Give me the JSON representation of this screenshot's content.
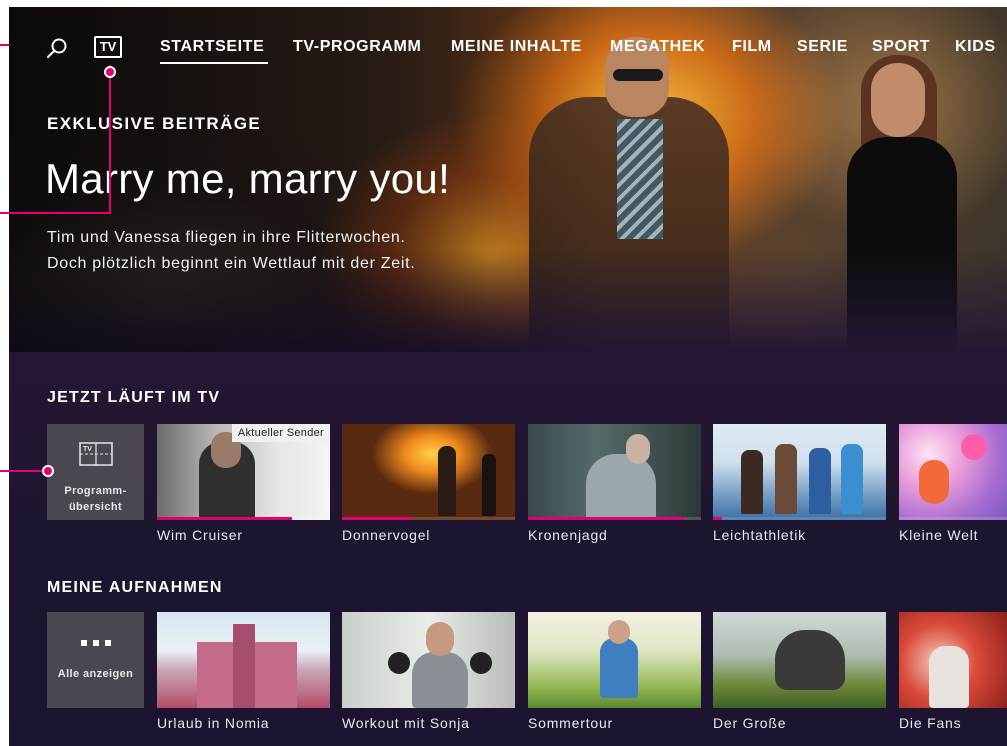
{
  "nav": {
    "tv_label": "TV",
    "items": [
      "STARTSEITE",
      "TV-PROGRAMM",
      "MEINE INHALTE",
      "MEGATHEK",
      "FILM",
      "SERIE",
      "SPORT",
      "KIDS"
    ],
    "active_index": 0
  },
  "hero": {
    "kicker": "EXKLUSIVE BEITRÄGE",
    "title": "Marry me, marry you!",
    "desc_line1": "Tim und Vanessa fliegen in ihre Flitterwochen.",
    "desc_line2": "Doch plötzlich beginnt ein Wettlauf mit der Zeit."
  },
  "now_on_tv": {
    "title": "JETZT LÄUFT IM TV",
    "guide_label_1": "Programm-",
    "guide_label_2": "übersicht",
    "current_badge": "Aktueller Sender",
    "items": [
      {
        "title": "Wim Cruiser",
        "progress": 0.78
      },
      {
        "title": "Donnervogel",
        "progress": 0.4
      },
      {
        "title": "Kronenjagd",
        "progress": 0.9
      },
      {
        "title": "Leichtathletik",
        "progress": 0.05
      },
      {
        "title": "Kleine Welt",
        "progress": 0.0
      }
    ]
  },
  "recordings": {
    "title": "MEINE AUFNAHMEN",
    "all_label": "Alle anzeigen",
    "items": [
      {
        "title": "Urlaub in Nomia"
      },
      {
        "title": "Workout mit Sonja"
      },
      {
        "title": "Sommertour"
      },
      {
        "title": "Der Große"
      },
      {
        "title": "Die Fans"
      }
    ]
  },
  "colors": {
    "accent": "#e20074",
    "background": "#241734"
  }
}
